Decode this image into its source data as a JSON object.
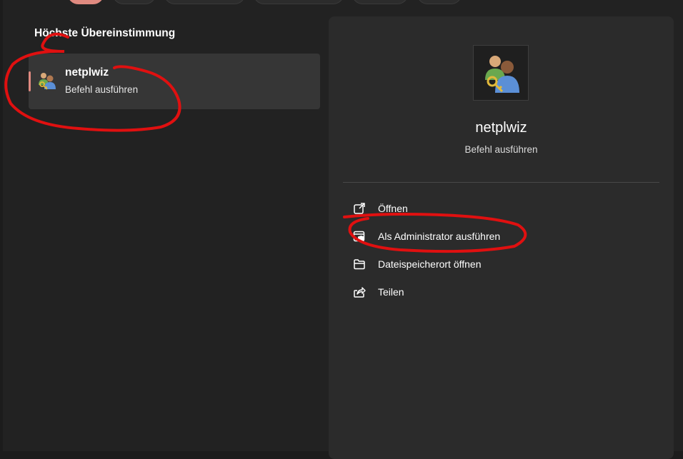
{
  "section": {
    "title": "Höchste Übereinstimmung"
  },
  "best_match": {
    "name": "netplwiz",
    "type": "Befehl ausführen",
    "icon": "users-key-icon"
  },
  "preview": {
    "name": "netplwiz",
    "type": "Befehl ausführen",
    "icon": "users-key-icon"
  },
  "actions": [
    {
      "label": "Öffnen",
      "icon": "open-external-icon"
    },
    {
      "label": "Als Administrator ausführen",
      "icon": "admin-shield-icon"
    },
    {
      "label": "Dateispeicherort öffnen",
      "icon": "folder-icon"
    },
    {
      "label": "Teilen",
      "icon": "share-icon"
    }
  ],
  "colors": {
    "accent": "#e08a80",
    "annotation": "#e01010",
    "background": "#222222",
    "panel": "#2b2b2b"
  }
}
